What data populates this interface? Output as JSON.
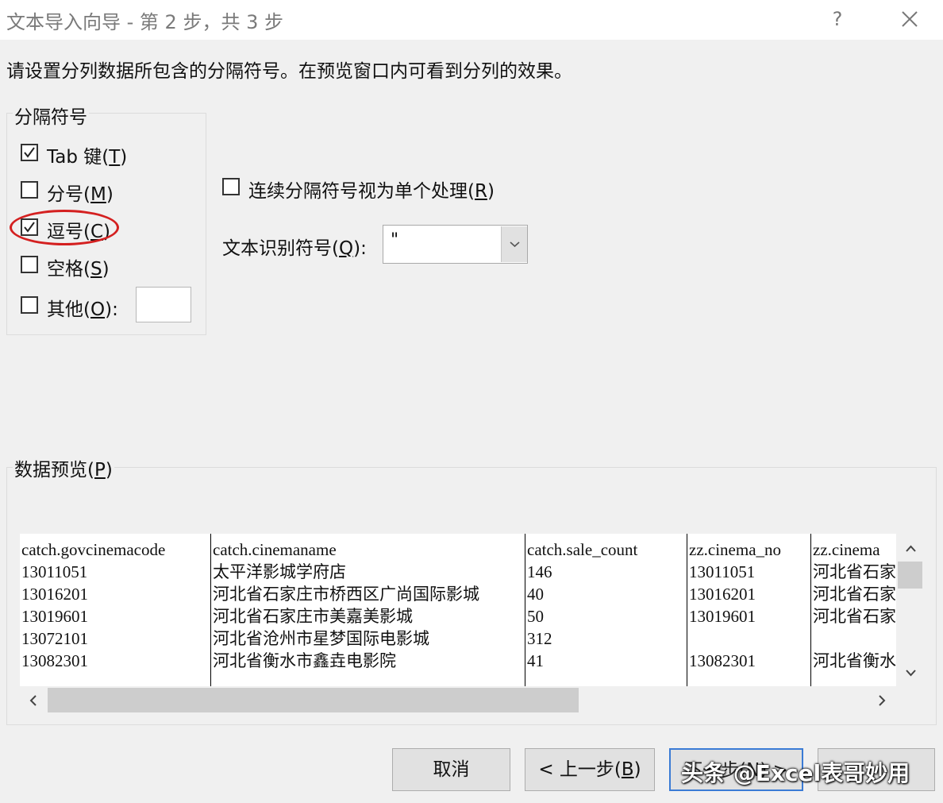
{
  "window": {
    "title": "文本导入向导 - 第 2 步，共 3 步",
    "help": "?"
  },
  "instruction": "请设置分列数据所包含的分隔符号。在预览窗口内可看到分列的效果。",
  "delimiters": {
    "group_label": "分隔符号",
    "tab": {
      "text": "Tab 键(",
      "key": "T",
      "end": ")",
      "checked": true
    },
    "semicolon": {
      "text": "分号(",
      "key": "M",
      "end": ")",
      "checked": false
    },
    "comma": {
      "text": "逗号(",
      "key": "C",
      "end": ")",
      "checked": true
    },
    "space": {
      "text": "空格(",
      "key": "S",
      "end": ")",
      "checked": false
    },
    "other": {
      "text": "其他(",
      "key": "O",
      "end": "):",
      "checked": false,
      "value": ""
    }
  },
  "consecutive": {
    "text": "连续分隔符号视为单个处理(",
    "key": "R",
    "end": ")",
    "checked": false
  },
  "qualifier": {
    "text": "文本识别符号(",
    "key": "Q",
    "end": "):",
    "value": "\""
  },
  "preview": {
    "label_text": "数据预览(",
    "label_key": "P",
    "label_end": ")",
    "columns": [
      [
        "catch.govcinemacode",
        "13011051",
        "13016201",
        "13019601",
        "13072101",
        "13082301"
      ],
      [
        "catch.cinemaname",
        "太平洋影城学府店",
        "河北省石家庄市桥西区广尚国际影城",
        "河北省石家庄市美嘉美影城",
        "河北省沧州市星梦国际电影城",
        "河北省衡水市鑫垚电影院"
      ],
      [
        "catch.sale_count",
        "146",
        "40",
        "50",
        "312",
        "41"
      ],
      [
        "zz.cinema_no",
        "13011051",
        "13016201",
        "13019601",
        "",
        "13082301"
      ],
      [
        "zz.cinema",
        "河北省石家",
        "河北省石家",
        "河北省石家",
        "",
        "河北省衡水"
      ]
    ]
  },
  "buttons": {
    "cancel": "取消",
    "back_text": "< 上一步(",
    "back_key": "B",
    "back_end": ")",
    "next": "下一步(N) >"
  },
  "watermark": "头条 @Excel表哥妙用",
  "colors": {
    "annotation": "#d42020",
    "default_button_border": "#3a7bd5"
  }
}
